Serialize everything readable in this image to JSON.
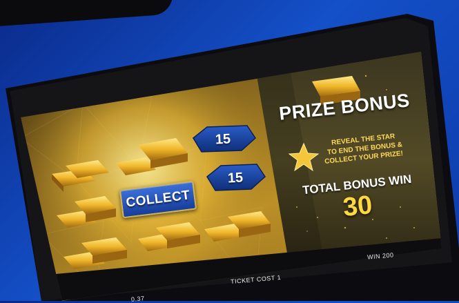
{
  "game": {
    "title": "PRIZE BONUS",
    "instructions_line1": "REVEAL THE STAR",
    "instructions_line2": "TO END THE BONUS &",
    "instructions_line3": "COLLECT YOUR PRIZE!",
    "total_bonus_label": "TOTAL BONUS WIN",
    "total_bonus_value": "30",
    "collect_label": "COLLECT",
    "hex_values": [
      "15",
      "15"
    ]
  },
  "footer": {
    "ticket_cost": "TICKET COST 1",
    "win": "WIN 200",
    "left_partial": "0.37"
  },
  "icons": {
    "star": "star-icon",
    "gold_bar": "gold-bar-icon"
  },
  "colors": {
    "background": "#1450c8",
    "gold": "#f2c335",
    "button_blue": "#2a5cc8"
  }
}
